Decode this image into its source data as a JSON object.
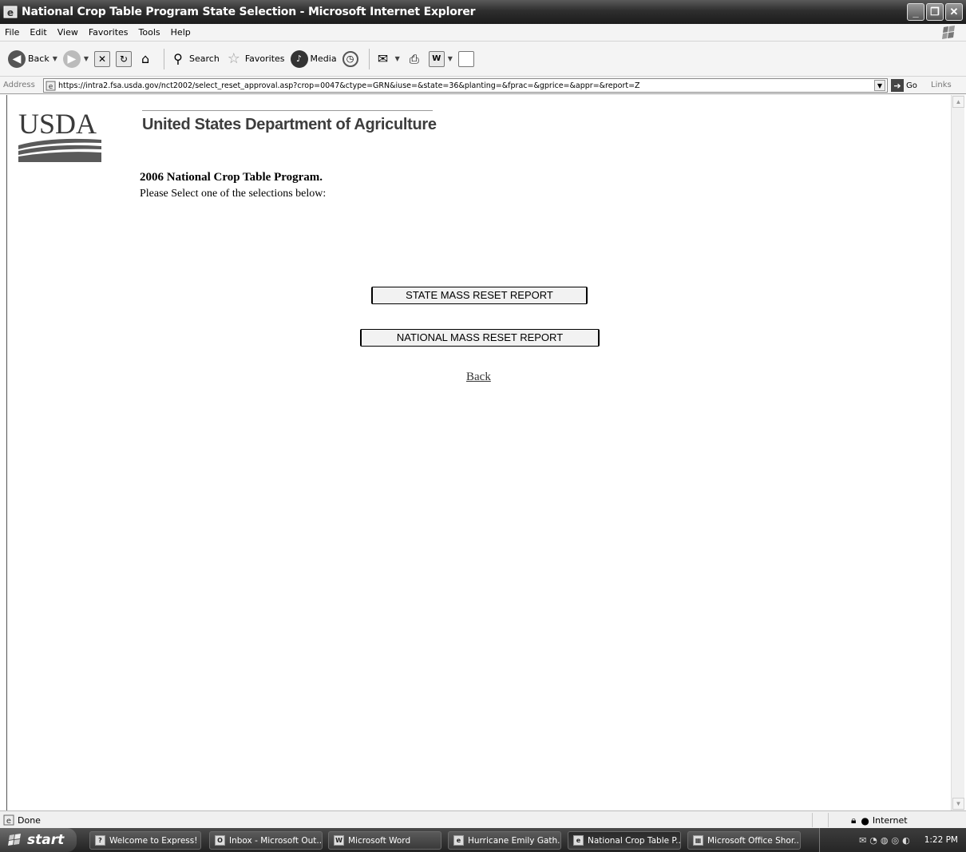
{
  "window": {
    "title": "National Crop Table Program State Selection - Microsoft Internet Explorer",
    "controls": {
      "minimize": "_",
      "restore": "❐",
      "close": "✕"
    }
  },
  "menu": [
    "File",
    "Edit",
    "View",
    "Favorites",
    "Tools",
    "Help"
  ],
  "toolbar": {
    "back": "Back",
    "search": "Search",
    "favorites": "Favorites",
    "media": "Media"
  },
  "address": {
    "label": "Address",
    "url": "https://intra2.fsa.usda.gov/nct2002/select_reset_approval.asp?crop=0047&ctype=GRN&iuse=&state=36&planting=&fprac=&gprice=&appr=&report=Z",
    "go": "Go",
    "links": "Links"
  },
  "page": {
    "logo_text": "USDA",
    "agency_name": "United States Department of Agriculture",
    "program_title": "2006 National Crop Table Program.",
    "instructions": "Please Select one of the selections below:",
    "buttons": {
      "state_report": "STATE MASS RESET REPORT",
      "national_report": "NATIONAL MASS RESET REPORT"
    },
    "back_link": "Back"
  },
  "status": {
    "text": "Done",
    "zone": "Internet"
  },
  "taskbar": {
    "start": "start",
    "tasks": [
      {
        "label": "Welcome to Express!",
        "icon": "help-icon"
      },
      {
        "label": "Inbox - Microsoft Out...",
        "icon": "outlook-icon"
      },
      {
        "label": "Microsoft Word",
        "icon": "word-icon"
      },
      {
        "label": "Hurricane Emily Gath...",
        "icon": "ie-icon"
      },
      {
        "label": "National Crop Table P...",
        "icon": "ie-icon",
        "active": true
      },
      {
        "label": "Microsoft Office Shor...",
        "icon": "office-icon"
      }
    ],
    "clock": "1:22 PM"
  }
}
